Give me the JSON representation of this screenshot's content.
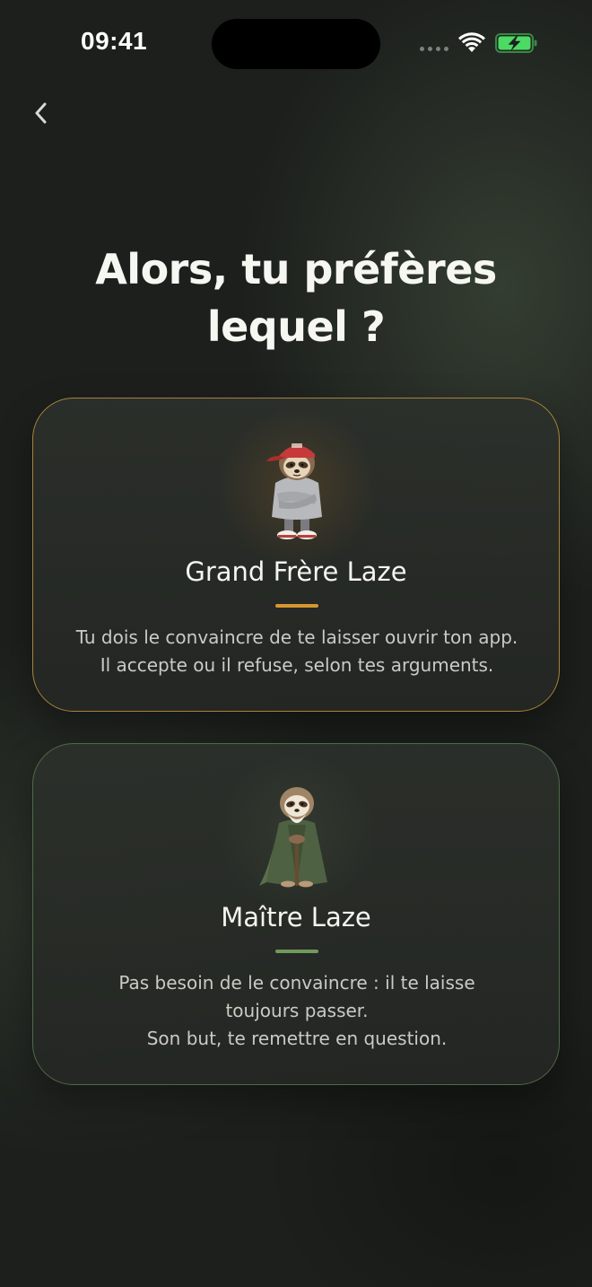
{
  "status_bar": {
    "time": "09:41"
  },
  "colors": {
    "background": "#1c1f1c",
    "grand_accent": "#d6972f",
    "maitre_accent": "#6f9a5c",
    "battery_green": "#4cd964"
  },
  "navigation": {
    "back_icon": "chevron-left-icon"
  },
  "title": "Alors, tu préfères\nlequel ?",
  "cards": [
    {
      "id": "grand",
      "title": "Grand Frère Laze",
      "description": "Tu dois le convaincre de te laisser ouvrir ton app.\nIl accepte ou il refuse, selon tes arguments.",
      "avatar": "sloth-cap-hoodie-avatar"
    },
    {
      "id": "maitre",
      "title": "Maître Laze",
      "description": "Pas besoin de le convaincre : il te laisse\ntoujours passer.\nSon but, te remettre en question.",
      "avatar": "sloth-robe-monk-avatar"
    }
  ]
}
